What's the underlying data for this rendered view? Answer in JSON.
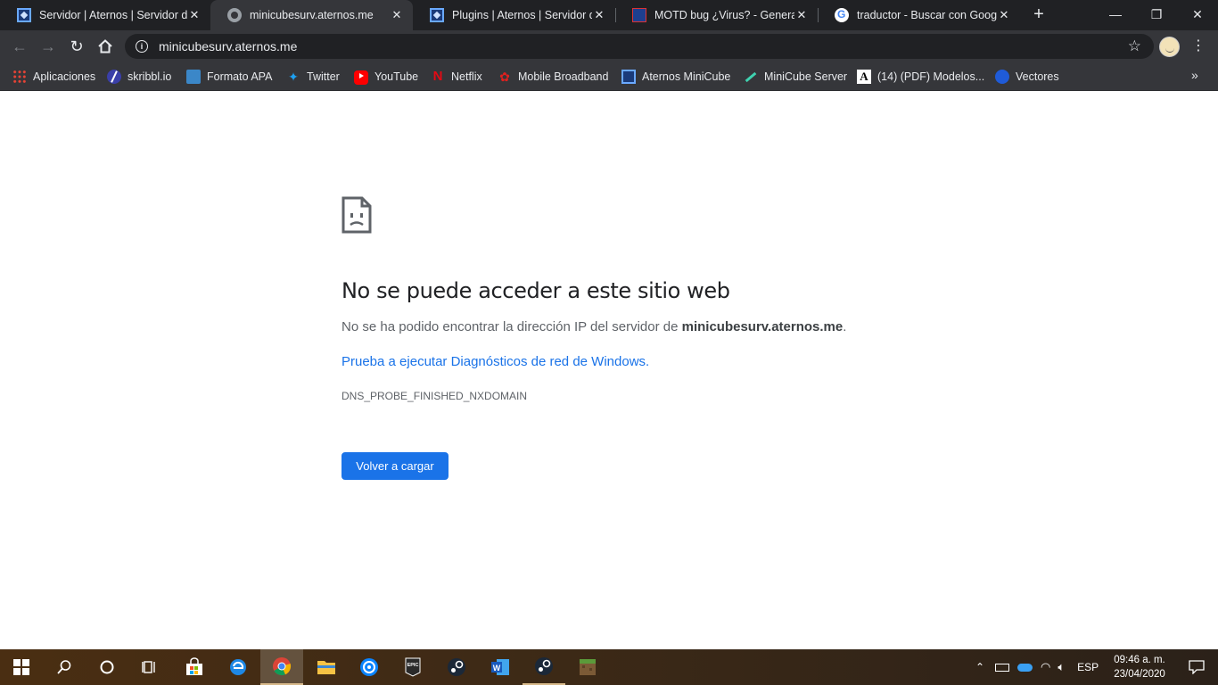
{
  "tabs": [
    {
      "title": "Servidor | Aternos | Servidor de",
      "icon": "aternos-icon",
      "active": false
    },
    {
      "title": "minicubesurv.aternos.me",
      "icon": "globe-icon",
      "active": true
    },
    {
      "title": "Plugins | Aternos | Servidor de",
      "icon": "aternos-icon",
      "active": false
    },
    {
      "title": "MOTD bug ¿Virus? - General -",
      "icon": "forum-icon",
      "active": false
    },
    {
      "title": "traductor - Buscar con Google",
      "icon": "google-icon",
      "active": false
    }
  ],
  "toolbar": {
    "url": "minicubesurv.aternos.me"
  },
  "bookmarks": [
    {
      "label": "Aplicaciones",
      "icon": "apps-grid-icon"
    },
    {
      "label": "skribbl.io",
      "icon": "skribbl-icon"
    },
    {
      "label": "Formato APA",
      "icon": "formato-icon"
    },
    {
      "label": "Twitter",
      "icon": "twitter-icon"
    },
    {
      "label": "YouTube",
      "icon": "youtube-icon"
    },
    {
      "label": "Netflix",
      "icon": "netflix-icon"
    },
    {
      "label": "Mobile Broadband",
      "icon": "huawei-icon"
    },
    {
      "label": "Aternos MiniCube",
      "icon": "aternos-icon"
    },
    {
      "label": "MiniCube Server",
      "icon": "sword-icon"
    },
    {
      "label": "(14) (PDF) Modelos...",
      "icon": "academia-icon"
    },
    {
      "label": "Vectores",
      "icon": "vectores-icon"
    }
  ],
  "error": {
    "title": "No se puede acceder a este sitio web",
    "text_prefix": "No se ha podido encontrar la dirección IP del servidor de ",
    "text_host": "minicubesurv.aternos.me",
    "text_suffix": ".",
    "link": "Prueba a ejecutar Diagnósticos de red de Windows.",
    "code": "DNS_PROBE_FINISHED_NXDOMAIN",
    "reload_label": "Volver a cargar"
  },
  "taskbar": {
    "apps": [
      "windows-start-icon",
      "search-icon",
      "cortana-icon",
      "task-view-icon",
      "store-icon",
      "edge-icon",
      "chrome-icon",
      "file-explorer-icon",
      "uplay-icon",
      "epic-games-icon",
      "steam-icon",
      "word-icon",
      "steam-icon",
      "minecraft-icon"
    ],
    "language": "ESP",
    "time": "09:46 a. m.",
    "date": "23/04/2020"
  },
  "colors": {
    "tab_strip": "#202124",
    "toolbar": "#35363a",
    "link": "#1a73e8",
    "button": "#1a73e8"
  }
}
